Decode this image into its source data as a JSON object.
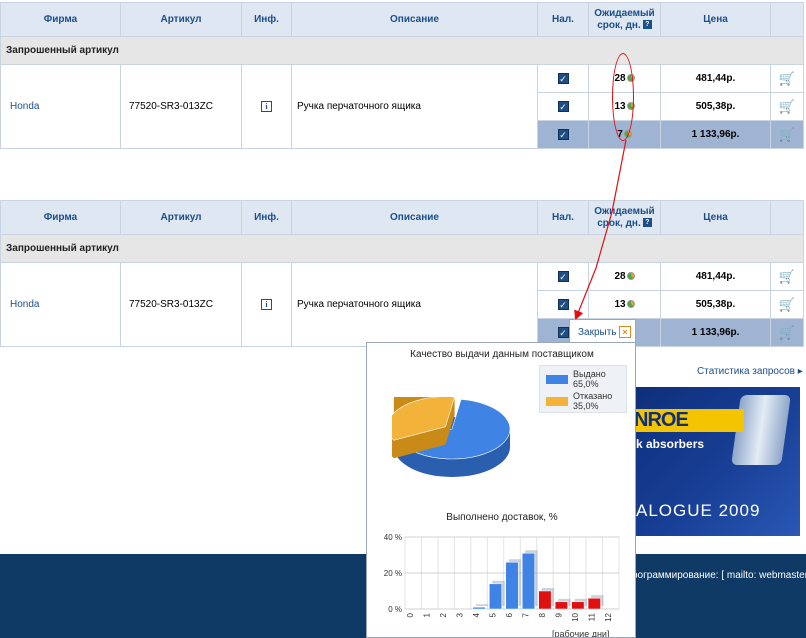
{
  "columns": [
    "Фирма",
    "Артикул",
    "Инф.",
    "Описание",
    "Нал.",
    "Ожидаемый срок, дн.",
    "Цена"
  ],
  "help_icon": "?",
  "section_label": "Запрошенный артикул",
  "item": {
    "brand": "Honda",
    "article": "77520-SR3-013ZC",
    "description": "Ручка перчаточного ящика"
  },
  "offers": [
    {
      "days": "28",
      "price": "481,44р."
    },
    {
      "days": "13",
      "price": "505,38р."
    },
    {
      "days": "7",
      "price": "1 133,96р."
    }
  ],
  "icons": {
    "info": "info-icon",
    "stock": "checkbox-checked-icon",
    "quality": "pie-chart-icon",
    "cart": "cart-icon"
  },
  "colors": {
    "header_bg": "#dfe7f2",
    "highlight_row": "#9fb4d2",
    "annotation": "#e01010",
    "footer": "#0f3a66"
  },
  "popup": {
    "close_label": "Закрыть",
    "pie_title": "Качество выдачи данным поставщиком",
    "legend": [
      {
        "label": "Выдано",
        "value": "65,0%",
        "color": "#3f84e5"
      },
      {
        "label": "Отказано",
        "value": "35,0%",
        "color": "#f3b23a"
      }
    ],
    "bar_title": "Выполнено доставок, %",
    "axis_note": "[рабочие дни]"
  },
  "chart_data": [
    {
      "type": "pie",
      "title": "Качество выдачи данным поставщиком",
      "categories": [
        "Выдано",
        "Отказано"
      ],
      "values": [
        65.0,
        35.0
      ]
    },
    {
      "type": "bar",
      "title": "Выполнено доставок, %",
      "xlabel": "[рабочие дни]",
      "categories": [
        "0",
        "1",
        "2",
        "3",
        "4",
        "5",
        "6",
        "7",
        "8",
        "9",
        "10",
        "11",
        "12"
      ],
      "series": [
        {
          "values": [
            0,
            0,
            0,
            0,
            1,
            14,
            26,
            31,
            10,
            4,
            4,
            6,
            0
          ]
        }
      ],
      "colors_by_category": [
        "#3f84e5",
        "#3f84e5",
        "#3f84e5",
        "#3f84e5",
        "#3f84e5",
        "#3f84e5",
        "#3f84e5",
        "#3f84e5",
        "#e01010",
        "#e01010",
        "#e01010",
        "#e01010",
        "#e01010"
      ],
      "ylim": [
        0,
        40
      ],
      "yticks": [
        "0 %",
        "20 %",
        "40 %"
      ],
      "grid": true
    }
  ],
  "stats_link": "Статистика запросов",
  "banner": {
    "brand": "NROE",
    "subtitle": "k absorbers",
    "catalogue": "ALOGUE 2009"
  },
  "footer_text": "рограммирование: [ mailto: webmaster"
}
